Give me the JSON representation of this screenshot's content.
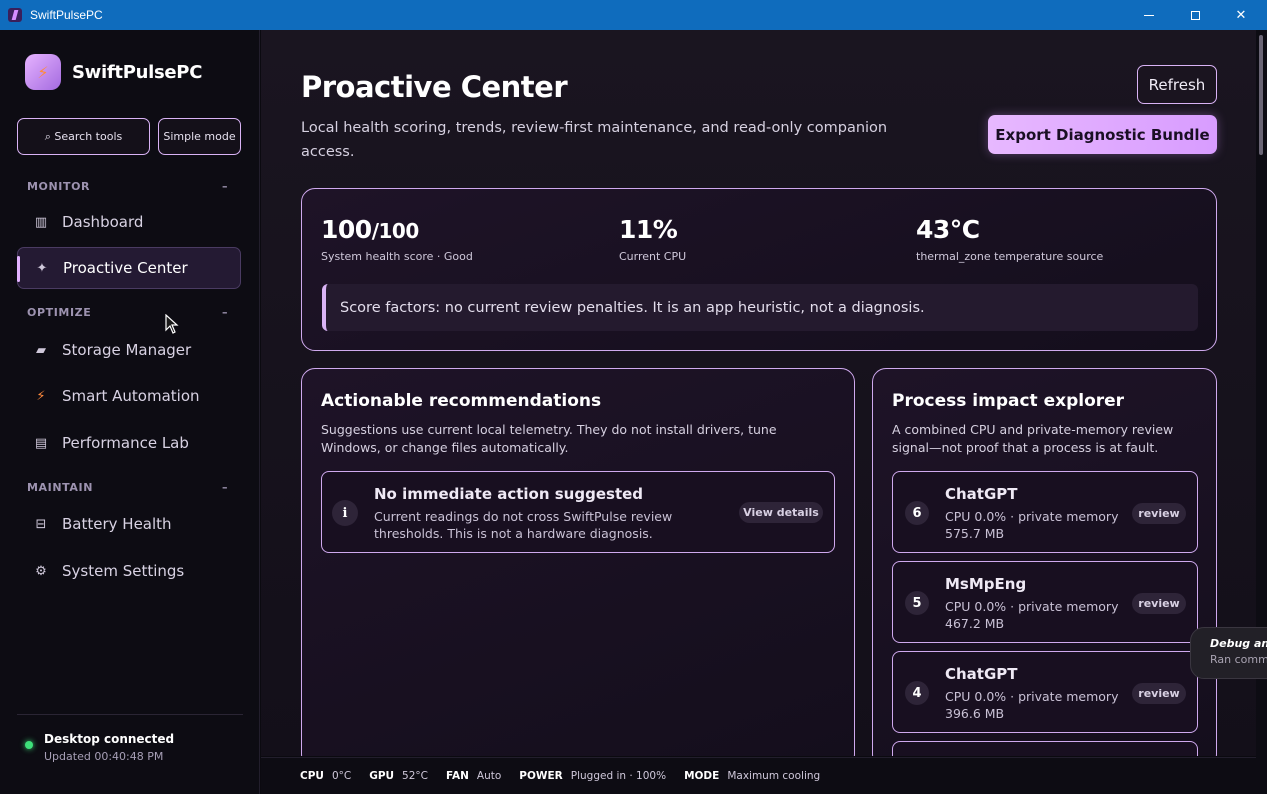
{
  "window": {
    "title": "SwiftPulsePC"
  },
  "sidebar": {
    "brand": "SwiftPulsePC",
    "search_label": "⌕ Search tools",
    "simple_mode_label": "Simple mode",
    "sections": [
      {
        "title": "MONITOR",
        "collapse": "–",
        "items": [
          {
            "label": "Dashboard",
            "icon": "▥"
          },
          {
            "label": "Proactive Center",
            "icon": "✦",
            "active": true
          }
        ]
      },
      {
        "title": "OPTIMIZE",
        "collapse": "–",
        "items": [
          {
            "label": "Storage Manager",
            "icon": "▰"
          },
          {
            "label": "Smart Automation",
            "icon": "⚡"
          },
          {
            "label": "Performance Lab",
            "icon": "▤"
          }
        ]
      },
      {
        "title": "MAINTAIN",
        "collapse": "–",
        "items": [
          {
            "label": "Battery Health",
            "icon": "⊟"
          },
          {
            "label": "System Settings",
            "icon": "⚙"
          }
        ]
      }
    ],
    "connection": {
      "title": "Desktop connected",
      "updated": "Updated 00:40:48 PM"
    }
  },
  "header": {
    "title": "Proactive Center",
    "subtitle": "Local health scoring, trends, review-first maintenance, and read-only companion access.",
    "refresh_label": "Refresh",
    "export_label": "Export Diagnostic Bundle"
  },
  "metrics": [
    {
      "value": "100",
      "suffix": "/100",
      "label": "System health score · Good"
    },
    {
      "value": "11%",
      "suffix": "",
      "label": "Current CPU"
    },
    {
      "value": "43°C",
      "suffix": "",
      "label": "thermal_zone temperature source"
    }
  ],
  "score_factors": "Score factors: no current review penalties. It is an app heuristic, not a diagnosis.",
  "recommendations": {
    "title": "Actionable recommendations",
    "description": "Suggestions use current local telemetry. They do not install drivers, tune Windows, or change files automatically.",
    "items": [
      {
        "icon": "i",
        "title": "No immediate action suggested",
        "description": "Current readings do not cross SwiftPulse review thresholds. This is not a hardware diagnosis.",
        "action": "View details"
      }
    ]
  },
  "process_explorer": {
    "title": "Process impact explorer",
    "description": "A combined CPU and private-memory review signal—not proof that a process is at fault.",
    "items": [
      {
        "rank": "6",
        "name": "ChatGPT",
        "meta": "CPU 0.0% · private memory 575.7 MB",
        "action": "review"
      },
      {
        "rank": "5",
        "name": "MsMpEng",
        "meta": "CPU 0.0% · private memory 467.2 MB",
        "action": "review"
      },
      {
        "rank": "4",
        "name": "ChatGPT",
        "meta": "CPU 0.0% · private memory 396.6 MB",
        "action": "review"
      }
    ]
  },
  "statusbar": [
    {
      "key": "CPU",
      "value": "0°C"
    },
    {
      "key": "GPU",
      "value": "52°C"
    },
    {
      "key": "FAN",
      "value": "Auto"
    },
    {
      "key": "POWER",
      "value": "Plugged in · 100%"
    },
    {
      "key": "MODE",
      "value": "Maximum cooling"
    }
  ],
  "toast": {
    "title": "Debug and",
    "subtitle": "Ran comm"
  },
  "colors": {
    "accent": "#d9b3f5",
    "titlebar": "#0f6cbd",
    "connected": "#3ee07a",
    "background": "#0b0a10"
  }
}
